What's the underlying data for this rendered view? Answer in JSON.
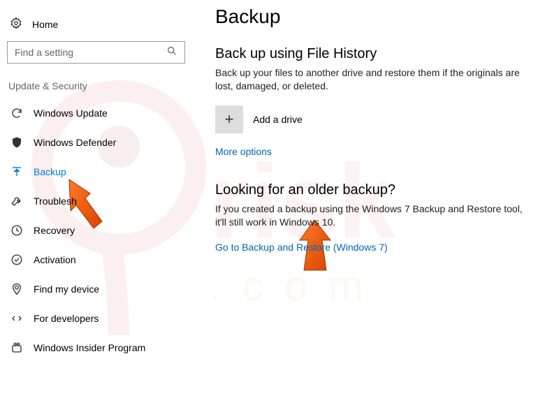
{
  "header": {
    "home_label": "Home"
  },
  "search": {
    "placeholder": "Find a setting"
  },
  "sidebar": {
    "category": "Update & Security",
    "items": [
      {
        "label": "Windows Update"
      },
      {
        "label": "Windows Defender"
      },
      {
        "label": "Backup"
      },
      {
        "label": "Troublesh"
      },
      {
        "label": "Recovery"
      },
      {
        "label": "Activation"
      },
      {
        "label": "Find my device"
      },
      {
        "label": "For developers"
      },
      {
        "label": "Windows Insider Program"
      }
    ]
  },
  "main": {
    "title": "Backup",
    "section1": {
      "heading": "Back up using File History",
      "desc": "Back up your files to another drive and restore them if the originals are lost, damaged, or deleted.",
      "add_drive_label": "Add a drive",
      "more_options": "More options"
    },
    "section2": {
      "heading": "Looking for an older backup?",
      "desc": "If you created a backup using the Windows 7 Backup and Restore tool, it'll still work in Windows 10.",
      "link": "Go to Backup and Restore (Windows 7)"
    }
  }
}
